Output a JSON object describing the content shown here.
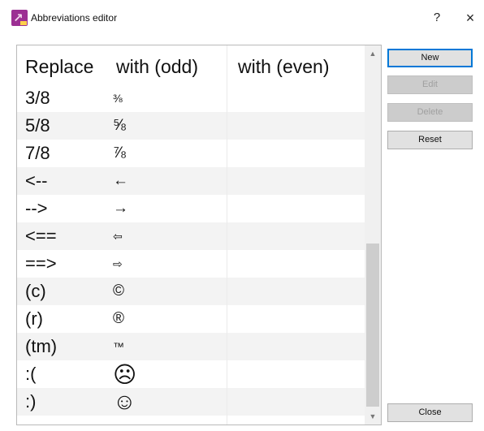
{
  "window": {
    "title": "Abbreviations editor",
    "help": "?",
    "close": "×"
  },
  "table": {
    "headers": [
      "Replace",
      "with (odd)",
      "with (even)"
    ],
    "rows": [
      {
        "replace": "3/8",
        "odd": "⅜",
        "even": ""
      },
      {
        "replace": "5/8",
        "odd": "⅝",
        "even": ""
      },
      {
        "replace": "7/8",
        "odd": "⅞",
        "even": ""
      },
      {
        "replace": "<--",
        "odd": "←",
        "even": ""
      },
      {
        "replace": "-->",
        "odd": "→",
        "even": ""
      },
      {
        "replace": "<==",
        "odd": "⇦",
        "even": ""
      },
      {
        "replace": "==>",
        "odd": "⇨",
        "even": ""
      },
      {
        "replace": "(c)",
        "odd": "©",
        "even": ""
      },
      {
        "replace": "(r)",
        "odd": "®",
        "even": ""
      },
      {
        "replace": "(tm)",
        "odd": "™",
        "even": ""
      },
      {
        "replace": ":(",
        "odd": "☹",
        "even": ""
      },
      {
        "replace": ":)",
        "odd": "☺",
        "even": ""
      }
    ]
  },
  "buttons": {
    "new": "New",
    "edit": "Edit",
    "delete": "Delete",
    "reset": "Reset",
    "close": "Close"
  },
  "scrollbar": {
    "up_arrow": "▲",
    "down_arrow": "▼",
    "position": 0.85
  },
  "colors": {
    "icon": "#9c2f93",
    "default_button_border": "#0078d7"
  }
}
